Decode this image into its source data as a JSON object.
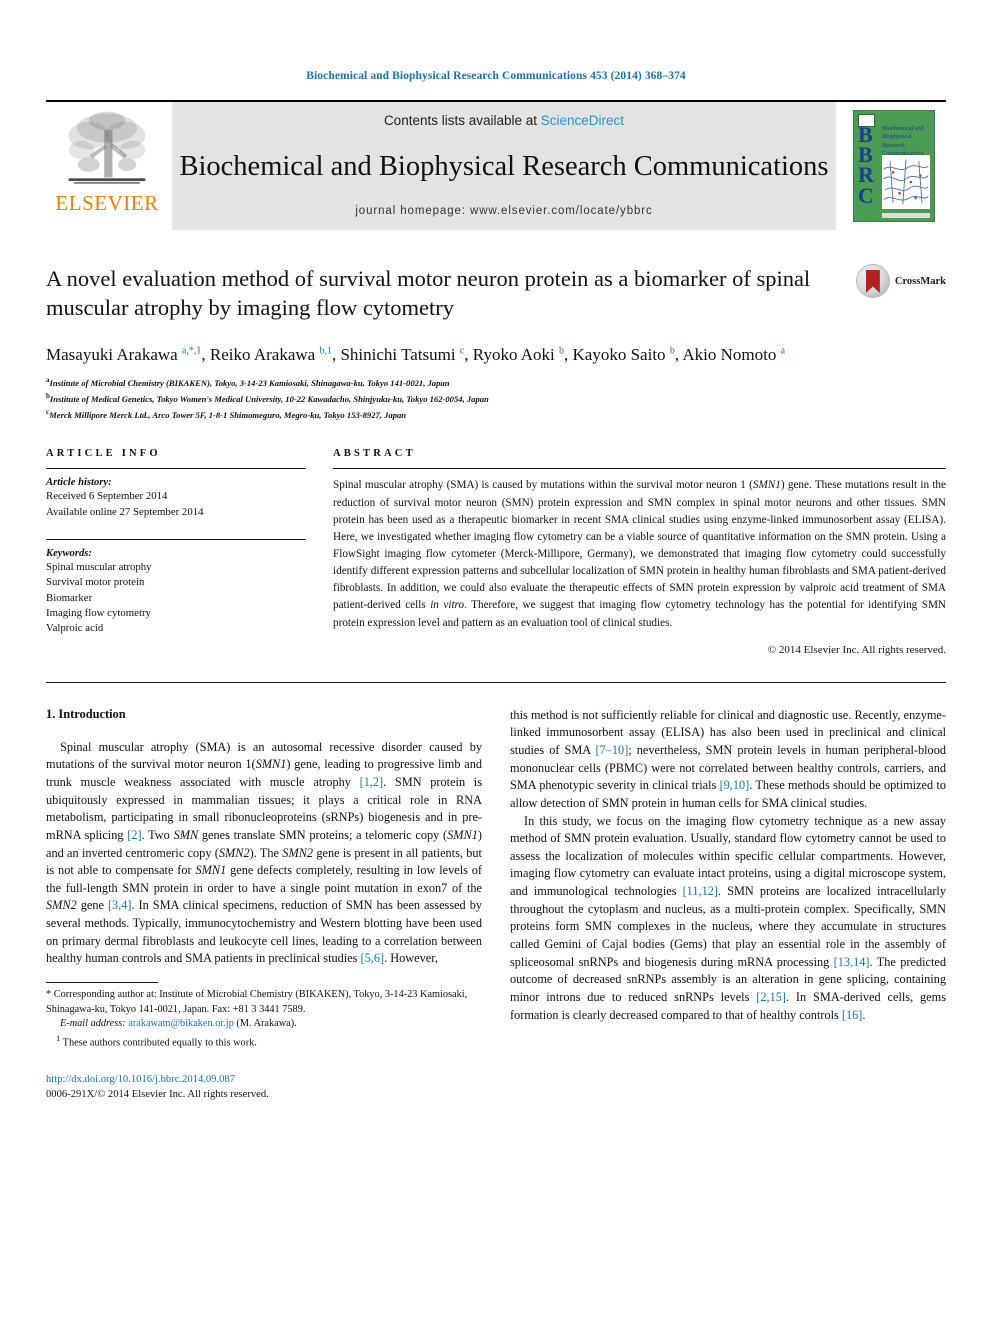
{
  "running_head": "Biochemical and Biophysical Research Communications 453 (2014) 368–374",
  "masthead": {
    "publisher_name": "ELSEVIER",
    "contents_prefix": "Contents lists available at ",
    "contents_link": "ScienceDirect",
    "journal_title": "Biochemical and Biophysical Research Communications",
    "homepage_line": "journal homepage: www.elsevier.com/locate/ybbrc",
    "cover": {
      "initials": "B\nB\nR\nC",
      "title_lines": [
        "Biochemical and",
        "Biophysical",
        "Research",
        "Communications"
      ]
    }
  },
  "article": {
    "title": "A novel evaluation method of survival motor neuron protein as a biomarker of spinal muscular atrophy by imaging flow cytometry",
    "crossmark_label": "CrossMark",
    "authors_html": "Masayuki Arakawa <sup>a,*,1</sup>, Reiko Arakawa <sup>b,1</sup>, Shinichi Tatsumi <sup>c</sup>, Ryoko Aoki <sup>b</sup>, Kayoko Saito <sup>b</sup>, Akio Nomoto <sup>a</sup>",
    "affiliations": [
      {
        "mark": "a",
        "text": "Institute of Microbial Chemistry (BIKAKEN), Tokyo, 3-14-23 Kamiosaki, Shinagawa-ku, Tokyo 141-0021, Japan"
      },
      {
        "mark": "b",
        "text": "Institute of Medical Genetics, Tokyo Women's Medical University, 10-22 Kawadacho, Shinjyuku-ku, Tokyo 162-0054, Japan"
      },
      {
        "mark": "c",
        "text": "Merck Millipore Merck Ltd., Arco Tower 5F, 1-8-1 Shimomeguro, Megro-ku, Tokyo 153-8927, Japan"
      }
    ]
  },
  "article_info": {
    "heading": "ARTICLE INFO",
    "history_label": "Article history:",
    "history_lines": [
      "Received 6 September 2014",
      "Available online 27 September 2014"
    ],
    "keywords_label": "Keywords:",
    "keywords": [
      "Spinal muscular atrophy",
      "Survival motor protein",
      "Biomarker",
      "Imaging flow cytometry",
      "Valproic acid"
    ]
  },
  "abstract": {
    "heading": "ABSTRACT",
    "body_html": "Spinal muscular atrophy (SMA) is caused by mutations within the survival motor neuron 1 (<i>SMN1</i>) gene. These mutations result in the reduction of survival motor neuron (SMN) protein expression and SMN complex in spinal motor neurons and other tissues. SMN protein has been used as a therapeutic biomarker in recent SMA clinical studies using enzyme-linked immunosorbent assay (ELISA). Here, we investigated whether imaging flow cytometry can be a viable source of quantitative information on the SMN protein. Using a FlowSight imaging flow cytometer (Merck-Millipore, Germany), we demonstrated that imaging flow cytometry could successfully identify different expression patterns and subcellular localization of SMN protein in healthy human fibroblasts and SMA patient-derived fibroblasts. In addition, we could also evaluate the therapeutic effects of SMN protein expression by valproic acid treatment of SMA patient-derived cells <i>in vitro</i>. Therefore, we suggest that imaging flow cytometry technology has the potential for identifying SMN protein expression level and pattern as an evaluation tool of clinical studies.",
    "copyright": "© 2014 Elsevier Inc. All rights reserved."
  },
  "body": {
    "section_heading": "1. Introduction",
    "left_paragraphs_html": [
      "Spinal muscular atrophy (SMA) is an autosomal recessive disorder caused by mutations of the survival motor neuron 1(<i>SMN1</i>) gene, leading to progressive limb and trunk muscle weakness associated with muscle atrophy <span class=\"ref\">[1,2]</span>. SMN protein is ubiquitously expressed in mammalian tissues; it plays a critical role in RNA metabolism, participating in small ribonucleoproteins (sRNPs) biogenesis and in pre-mRNA splicing <span class=\"ref\">[2]</span>. Two <i>SMN</i> genes translate SMN proteins; a telomeric copy (<i>SMN1</i>) and an inverted centromeric copy (<i>SMN2</i>). The <i>SMN2</i> gene is present in all patients, but is not able to compensate for <i>SMN1</i> gene defects completely, resulting in low levels of the full-length SMN protein in order to have a single point mutation in exon7 of the <i>SMN2</i> gene <span class=\"ref\">[3,4]</span>. In SMA clinical specimens, reduction of SMN has been assessed by several methods. Typically, immunocytochemistry and Western blotting have been used on primary dermal fibroblasts and leukocyte cell lines, leading to a correlation between healthy human controls and SMA patients in preclinical studies <span class=\"ref\">[5,6]</span>. However,"
    ],
    "right_paragraphs_html": [
      "this method is not sufficiently reliable for clinical and diagnostic use. Recently, enzyme-linked immunosorbent assay (ELISA) has also been used in preclinical and clinical studies of SMA <span class=\"ref\">[7–10]</span>; nevertheless, SMN protein levels in human peripheral-blood mononuclear cells (PBMC) were not correlated between healthy controls, carriers, and SMA phenotypic severity in clinical trials <span class=\"ref\">[9,10]</span>. These methods should be optimized to allow detection of SMN protein in human cells for SMA clinical studies.",
      "In this study, we focus on the imaging flow cytometry technique as a new assay method of SMN protein evaluation. Usually, standard flow cytometry cannot be used to assess the localization of molecules within specific cellular compartments. However, imaging flow cytometry can evaluate intact proteins, using a digital microscope system, and immunological technologies <span class=\"ref\">[11,12]</span>. SMN proteins are localized intracellularly throughout the cytoplasm and nucleus, as a multi-protein complex. Specifically, SMN proteins form SMN complexes in the nucleus, where they accumulate in structures called Gemini of Cajal bodies (Gems) that play an essential role in the assembly of spliceosomal snRNPs and biogenesis during mRNA processing <span class=\"ref\">[13,14]</span>. The predicted outcome of decreased snRNPs assembly is an alteration in gene splicing, containing minor introns due to reduced snRNPs levels <span class=\"ref\">[2,15]</span>. In SMA-derived cells, gems formation is clearly decreased compared to that of healthy controls <span class=\"ref\">[16]</span>."
    ]
  },
  "footnotes": {
    "corresponding_html": "<span class=\"sym\">*</span> Corresponding author at: Institute of Microbial Chemistry (BIKAKEN), Tokyo, 3-14-23 Kamiosaki, Shinagawa-ku, Tokyo 141-0021, Japan. Fax: +81 3 3441 7589.",
    "email_html": "<i>E-mail address:</i> <span class=\"link\">arakawam@bikaken.or.jp</span> (M. Arakawa).",
    "equal_contrib_html": "<sup>1</sup> These authors contributed equally to this work.",
    "doi": "http://dx.doi.org/10.1016/j.bbrc.2014.09.087",
    "issn_line": "0006-291X/© 2014 Elsevier Inc. All rights reserved."
  },
  "colors": {
    "link_blue": "#1673a8",
    "sciencedirect_blue": "#2196c4",
    "elsevier_orange": "#f07d00",
    "cover_green": "#4a9b53",
    "cover_navy": "#1e3e8f",
    "crossmark_red": "#b22222"
  }
}
